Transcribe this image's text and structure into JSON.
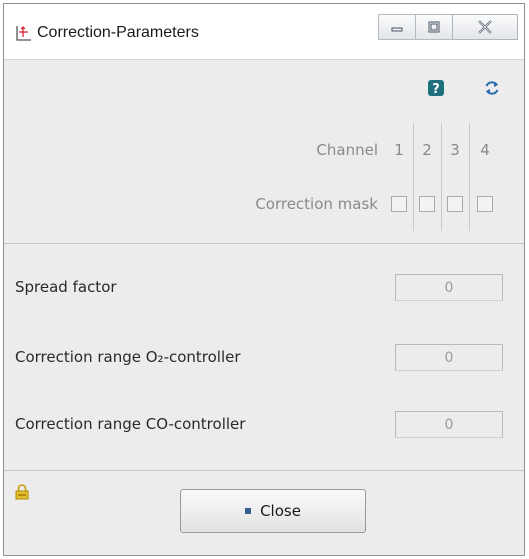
{
  "window": {
    "title": "Correction-Parameters",
    "icons": {
      "app": "axis-cross-icon",
      "minimize": "minimize-icon",
      "maximize": "maximize-icon",
      "close": "close-icon"
    }
  },
  "toolbar": {
    "help_icon": "help-icon",
    "refresh_icon": "refresh-icon"
  },
  "channel_grid": {
    "channel_label": "Channel",
    "mask_label": "Correction mask",
    "channels": [
      "1",
      "2",
      "3",
      "4"
    ],
    "mask_checked": [
      false,
      false,
      false,
      false
    ]
  },
  "parameters": [
    {
      "label": "Spread factor",
      "value": "0"
    },
    {
      "label": "Correction range O₂-controller",
      "value": "0"
    },
    {
      "label": "Correction range CO-controller",
      "value": "0"
    }
  ],
  "footer": {
    "lock_icon": "lock-icon",
    "close_label": "Close"
  },
  "colors": {
    "help_accent": "#1f6f7f",
    "refresh_accent": "#2a6bb0",
    "lock_accent": "#d8b21e"
  }
}
